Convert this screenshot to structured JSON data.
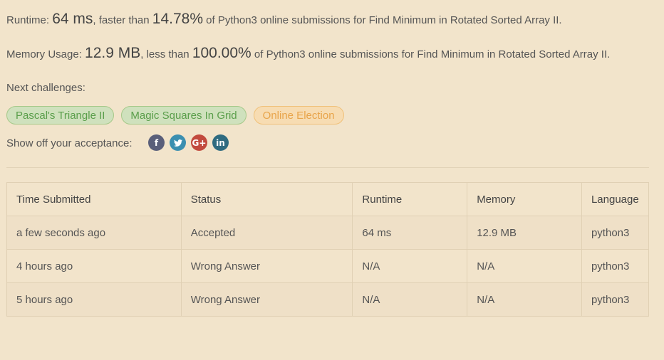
{
  "runtime_line": {
    "prefix": "Runtime: ",
    "value": "64 ms",
    "middle": ", faster than ",
    "percent": "14.78%",
    "suffix": " of Python3 online submissions for Find Minimum in Rotated Sorted Array II."
  },
  "memory_line": {
    "prefix": "Memory Usage: ",
    "value": "12.9 MB",
    "middle": ", less than ",
    "percent": "100.00%",
    "suffix": " of Python3 online submissions for Find Minimum in Rotated Sorted Array II."
  },
  "next_challenges": {
    "label": "Next challenges:",
    "items": [
      {
        "label": "Pascal's Triangle II",
        "difficulty": "easy"
      },
      {
        "label": "Magic Squares In Grid",
        "difficulty": "easy"
      },
      {
        "label": "Online Election",
        "difficulty": "medium"
      }
    ]
  },
  "share": {
    "label": "Show off your acceptance:",
    "icons": [
      {
        "name": "facebook-icon",
        "glyph": "f",
        "color": "#5a5f7a"
      },
      {
        "name": "twitter-icon",
        "glyph": "t",
        "color": "#3b8fb0"
      },
      {
        "name": "google-plus-icon",
        "glyph": "G+",
        "color": "#c24a3d"
      },
      {
        "name": "linkedin-icon",
        "glyph": "in",
        "color": "#2f6b80"
      }
    ]
  },
  "table": {
    "headers": [
      "Time Submitted",
      "Status",
      "Runtime",
      "Memory",
      "Language"
    ],
    "rows": [
      [
        "a few seconds ago",
        "Accepted",
        "64 ms",
        "12.9 MB",
        "python3"
      ],
      [
        "4 hours ago",
        "Wrong Answer",
        "N/A",
        "N/A",
        "python3"
      ],
      [
        "5 hours ago",
        "Wrong Answer",
        "N/A",
        "N/A",
        "python3"
      ]
    ]
  },
  "colors": {
    "background": "#f2e4cb",
    "accepted": "#3f8f6e",
    "wrong": "#a94848",
    "easy": "#5a9e4b",
    "medium": "#e8a44a"
  }
}
